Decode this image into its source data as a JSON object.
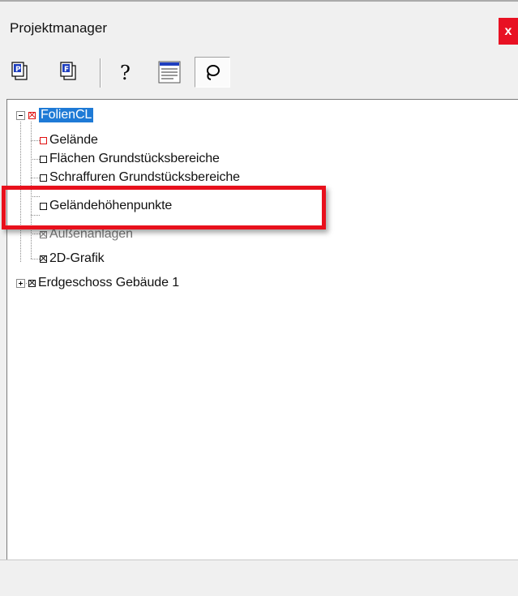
{
  "window": {
    "title": "Projektmanager",
    "close_label": "x"
  },
  "toolbar": {
    "buttons": [
      {
        "name": "project-p-icon",
        "letter": "P"
      },
      {
        "name": "project-f-icon",
        "letter": "F"
      },
      {
        "name": "help-icon",
        "glyph": "?"
      },
      {
        "name": "list-view-icon"
      },
      {
        "name": "lasso-icon"
      }
    ]
  },
  "tree": {
    "root": {
      "label": "FolienCL",
      "state": "expanded",
      "selected": true,
      "check": "x-red"
    },
    "children": [
      {
        "label": "Gelände",
        "check": "empty-red"
      },
      {
        "label": "Flächen Grundstücksbereiche",
        "check": "empty"
      },
      {
        "label": "Schraffuren Grundstücksbereiche",
        "check": "empty"
      },
      {
        "label": "Geländehöhenpunkte",
        "check": "empty"
      },
      {
        "label": "Außenanlagen",
        "check": "x"
      },
      {
        "label": "2D-Grafik",
        "check": "x"
      }
    ],
    "sibling": {
      "label": "Erdgeschoss Gebäude 1",
      "state": "collapsed",
      "check": "x"
    }
  },
  "colors": {
    "highlight": "#e8101c",
    "selection": "#1e7ad6",
    "close": "#e81123"
  }
}
